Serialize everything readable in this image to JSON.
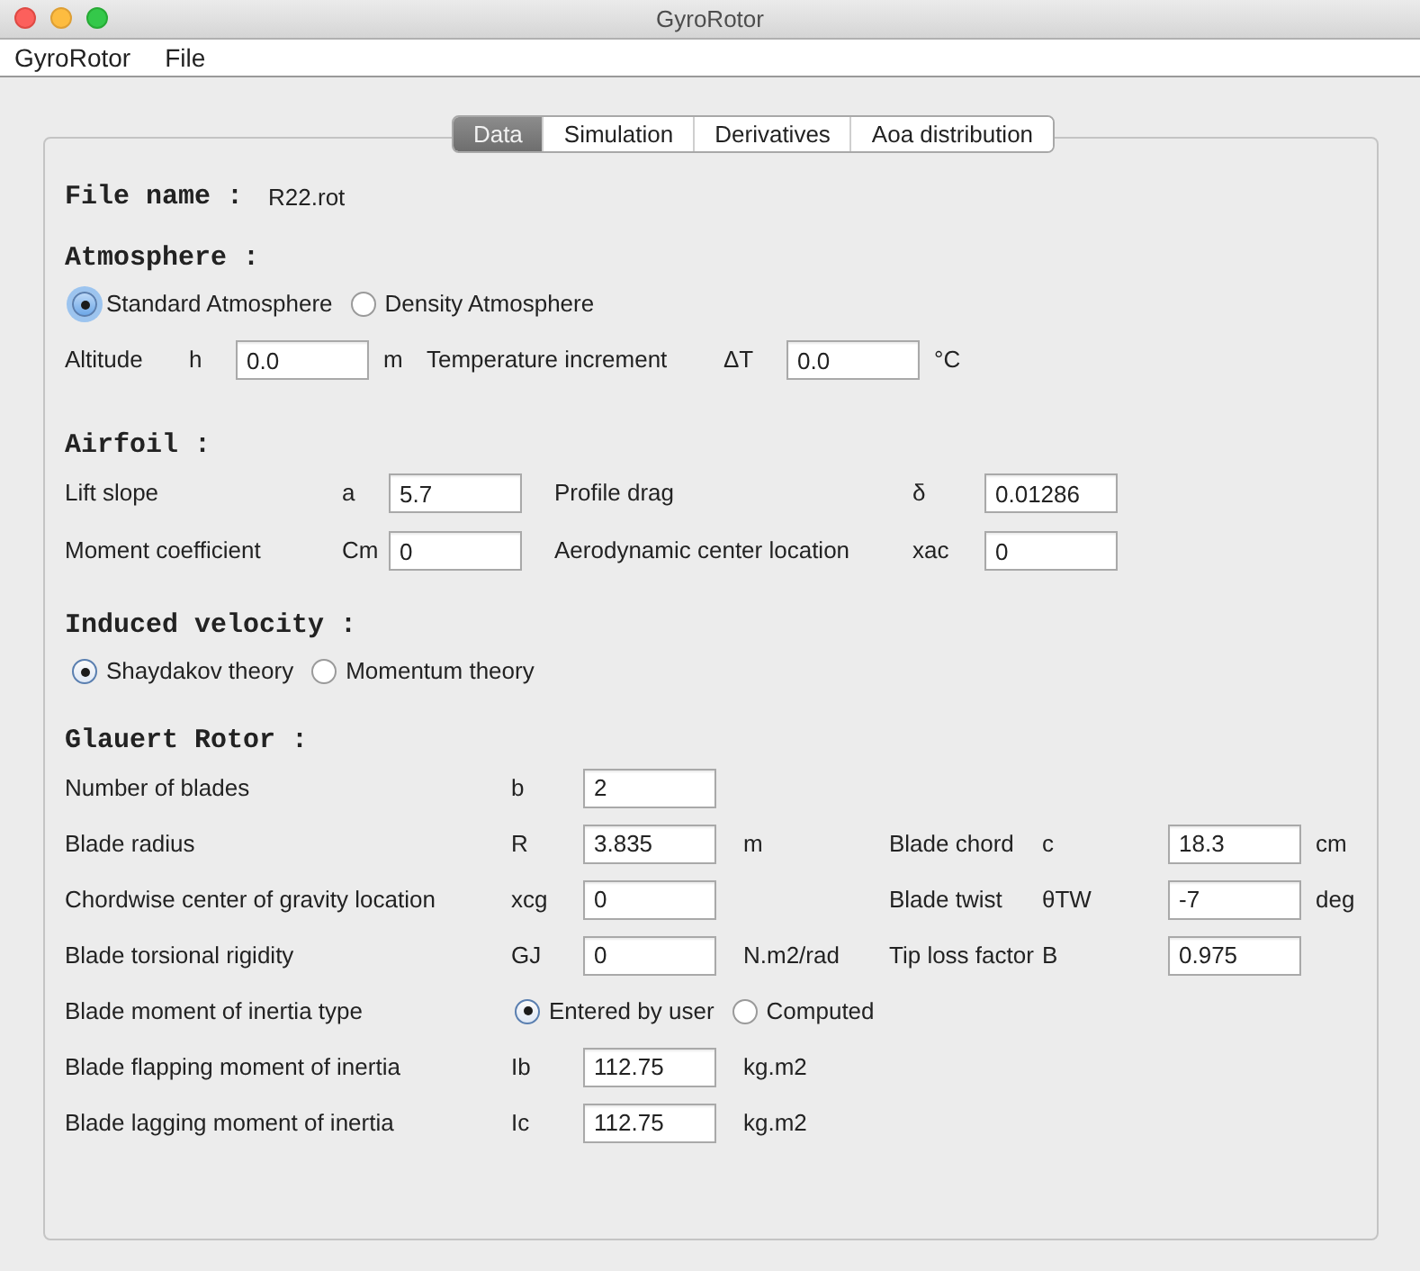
{
  "window": {
    "title": "GyroRotor"
  },
  "menu": [
    "GyroRotor",
    "File"
  ],
  "tabs": [
    {
      "label": "Data",
      "selected": true
    },
    {
      "label": "Simulation",
      "selected": false
    },
    {
      "label": "Derivatives",
      "selected": false
    },
    {
      "label": "Aoa distribution",
      "selected": false
    }
  ],
  "file": {
    "label": "File name :",
    "value": "R22.rot"
  },
  "sections": [
    {
      "title": "Atmosphere :",
      "radios": [
        {
          "label": "Standard Atmosphere",
          "selected": true,
          "focused": true
        },
        {
          "label": "Density Atmosphere",
          "selected": false,
          "focused": false
        }
      ],
      "rows": [
        {
          "kind": "fields",
          "fields": [
            {
              "label": "Altitude",
              "symbol": "h",
              "value": "0.0",
              "unit": "m"
            },
            {
              "label": "Temperature increment",
              "symbol": "ΔT",
              "value": "0.0",
              "unit": "°C"
            }
          ]
        }
      ]
    },
    {
      "title": "Airfoil :",
      "rows": [
        {
          "kind": "fields",
          "fields": [
            {
              "label": "Lift slope",
              "symbol": "a",
              "value": "5.7"
            },
            {
              "label": "Profile drag",
              "symbol": "δ",
              "value": "0.01286"
            }
          ]
        },
        {
          "kind": "fields",
          "fields": [
            {
              "label": "Moment coefficient",
              "symbol": "Cm",
              "value": "0"
            },
            {
              "label": "Aerodynamic center location",
              "symbol": "xac",
              "value": "0"
            }
          ]
        }
      ]
    },
    {
      "title": "Induced velocity :",
      "radios": [
        {
          "label": "Shaydakov theory",
          "selected": true,
          "focused": false
        },
        {
          "label": "Momentum theory",
          "selected": false,
          "focused": false
        }
      ]
    },
    {
      "title": "Glauert Rotor :",
      "rows": [
        {
          "kind": "fields",
          "fields": [
            {
              "label": "Number of blades",
              "symbol": "b",
              "value": "2"
            }
          ]
        },
        {
          "kind": "fields",
          "fields": [
            {
              "label": "Blade radius",
              "symbol": "R",
              "value": "3.835",
              "unit": "m"
            },
            {
              "label": "Blade chord",
              "symbol": "c",
              "value": "18.3",
              "unit": "cm"
            }
          ]
        },
        {
          "kind": "fields",
          "fields": [
            {
              "label": "Chordwise center of gravity location",
              "symbol": "xcg",
              "value": "0"
            },
            {
              "label": "Blade twist",
              "symbol": "θTW",
              "value": "-7",
              "unit": "deg"
            }
          ]
        },
        {
          "kind": "fields",
          "fields": [
            {
              "label": "Blade torsional rigidity",
              "symbol": "GJ",
              "value": "0",
              "unit": "N.m2/rad"
            },
            {
              "label": "Tip loss factor",
              "symbol": "B",
              "value": "0.975"
            }
          ]
        },
        {
          "kind": "choice",
          "label": "Blade moment of inertia type",
          "radios": [
            {
              "label": "Entered by user",
              "selected": true,
              "focused": false
            },
            {
              "label": "Computed",
              "selected": false,
              "focused": false
            }
          ]
        },
        {
          "kind": "fields",
          "fields": [
            {
              "label": "Blade flapping moment of inertia",
              "symbol": "Ib",
              "value": "112.75",
              "unit": "kg.m2"
            }
          ]
        },
        {
          "kind": "fields",
          "fields": [
            {
              "label": "Blade lagging moment of inertia",
              "symbol": "Ic",
              "value": "112.75",
              "unit": "kg.m2"
            }
          ]
        }
      ]
    }
  ]
}
